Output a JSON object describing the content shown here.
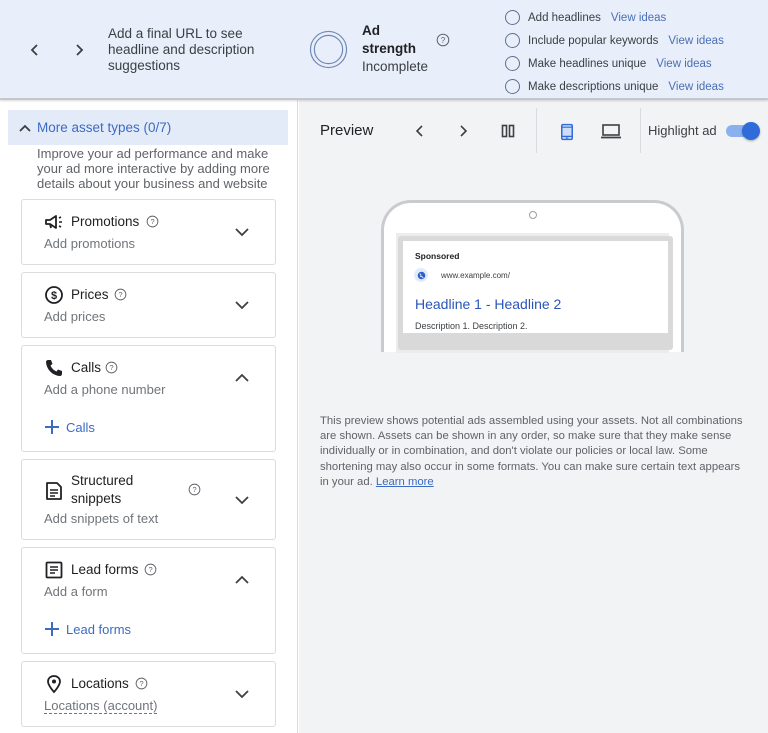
{
  "topbar": {
    "suggestion_text": "Add a final URL to see headline and description suggestions",
    "ad_strength": {
      "title": "Ad strength",
      "status": "Incomplete"
    },
    "checklist": [
      {
        "label": "Add headlines",
        "link": "View ideas"
      },
      {
        "label": "Include popular keywords",
        "link": "View ideas"
      },
      {
        "label": "Make headlines unique",
        "link": "View ideas"
      },
      {
        "label": "Make descriptions unique",
        "link": "View ideas"
      }
    ]
  },
  "left": {
    "more_assets_label": "More asset types (0/7)",
    "intro": "Improve your ad performance and make your ad more interactive by adding more details about your business and website",
    "cards": [
      {
        "title": "Promotions",
        "subtitle": "Add promotions",
        "expanded": false
      },
      {
        "title": "Prices",
        "subtitle": "Add prices",
        "expanded": false
      },
      {
        "title": "Calls",
        "subtitle": "Add a phone number",
        "expanded": true,
        "add_label": "Calls"
      },
      {
        "title": "Structured snippets",
        "subtitle": "Add snippets of text",
        "expanded": false
      },
      {
        "title": "Lead forms",
        "subtitle": "Add a form",
        "expanded": true,
        "add_label": "Lead forms"
      },
      {
        "title": "Locations",
        "subtitle": "Locations (account)",
        "expanded": false
      }
    ]
  },
  "preview": {
    "title": "Preview",
    "highlight_label": "Highlight ad",
    "highlight_on": true,
    "device_selected": "mobile",
    "ad": {
      "sponsored": "Sponsored",
      "url": "www.example.com/",
      "headline": "Headline 1 - Headline 2",
      "description": "Description 1. Description 2."
    },
    "disclaimer": "This preview shows potential ads assembled using your assets. Not all combinations are shown. Assets can be shown in any order, so make sure that they make sense individually or in combination, and don't violate our policies or local law. Some shortening may also occur in some formats. You can make sure certain text appears in your ad.",
    "learn_more": "Learn more"
  },
  "colors": {
    "accent": "#3c6bc4",
    "topbar_bg": "#e8eefa",
    "preview_bg": "#f1f3f4",
    "toggle_on": "#2f6bd9"
  }
}
